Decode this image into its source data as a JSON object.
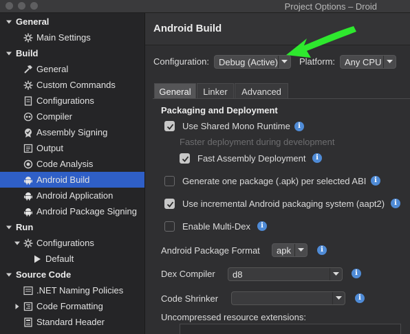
{
  "window": {
    "title": "Project Options – Droid"
  },
  "sidebar": {
    "items": [
      {
        "label": "General",
        "level": 0,
        "expanded": true,
        "bold": true,
        "icon": "none"
      },
      {
        "label": "Main Settings",
        "level": 1,
        "icon": "gear-icon"
      },
      {
        "label": "Build",
        "level": 0,
        "expanded": true,
        "bold": true,
        "icon": "none"
      },
      {
        "label": "General",
        "level": 1,
        "icon": "hammer-icon"
      },
      {
        "label": "Custom Commands",
        "level": 1,
        "icon": "gear-icon"
      },
      {
        "label": "Configurations",
        "level": 1,
        "icon": "document-icon"
      },
      {
        "label": "Compiler",
        "level": 1,
        "icon": "compiler-icon"
      },
      {
        "label": "Assembly Signing",
        "level": 1,
        "icon": "badge-icon"
      },
      {
        "label": "Output",
        "level": 1,
        "icon": "output-icon"
      },
      {
        "label": "Code Analysis",
        "level": 1,
        "icon": "target-icon"
      },
      {
        "label": "Android Build",
        "level": 1,
        "icon": "android-icon",
        "selected": true
      },
      {
        "label": "Android Application",
        "level": 1,
        "icon": "android-icon"
      },
      {
        "label": "Android Package Signing",
        "level": 1,
        "icon": "android-icon"
      },
      {
        "label": "Run",
        "level": 0,
        "expanded": true,
        "bold": true,
        "icon": "none"
      },
      {
        "label": "Configurations",
        "level": 1,
        "expanded": true,
        "icon": "gear-icon"
      },
      {
        "label": "Default",
        "level": 2,
        "icon": "play-icon"
      },
      {
        "label": "Source Code",
        "level": 0,
        "expanded": true,
        "bold": true,
        "icon": "none"
      },
      {
        "label": ".NET Naming Policies",
        "level": 1,
        "icon": "naming-icon"
      },
      {
        "label": "Code Formatting",
        "level": 1,
        "expanded": false,
        "icon": "formatting-icon"
      },
      {
        "label": "Standard Header",
        "level": 1,
        "icon": "header-icon"
      }
    ]
  },
  "main": {
    "title": "Android Build",
    "configuration_label": "Configuration:",
    "configuration_value": "Debug (Active)",
    "platform_label": "Platform:",
    "platform_value": "Any CPU",
    "tabs": [
      {
        "label": "General",
        "active": true
      },
      {
        "label": "Linker",
        "active": false
      },
      {
        "label": "Advanced",
        "active": false
      }
    ],
    "section_title": "Packaging and Deployment",
    "options": {
      "shared_runtime": {
        "label": "Use Shared Mono Runtime",
        "checked": true
      },
      "shared_runtime_hint": "Faster deployment during development",
      "fast_deploy": {
        "label": "Fast Assembly Deployment",
        "checked": true
      },
      "per_abi": {
        "label": "Generate one package (.apk) per selected ABI",
        "checked": false
      },
      "aapt2": {
        "label": "Use incremental Android packaging system (aapt2)",
        "checked": true
      },
      "multidex": {
        "label": "Enable Multi-Dex",
        "checked": false
      }
    },
    "package_format_label": "Android Package Format",
    "package_format_value": "apk",
    "dex_compiler_label": "Dex Compiler",
    "dex_compiler_value": "d8",
    "code_shrinker_label": "Code Shrinker",
    "code_shrinker_value": "",
    "uncompressed_label": "Uncompressed resource extensions:",
    "info_glyph": "i"
  },
  "colors": {
    "selection": "#2f5fc7",
    "info": "#4f8bd6",
    "arrow": "#2ee82e"
  }
}
